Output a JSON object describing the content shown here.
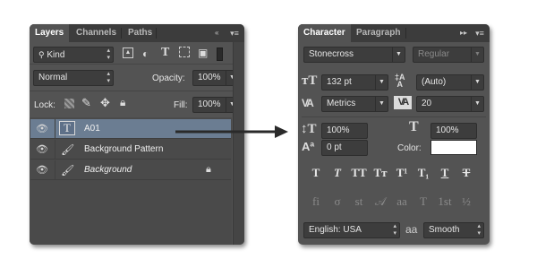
{
  "layers_panel": {
    "tabs": [
      "Layers",
      "Channels",
      "Paths"
    ],
    "filter_kind": "Kind",
    "blend_mode": "Normal",
    "opacity_label": "Opacity:",
    "opacity_value": "100%",
    "lock_label": "Lock:",
    "fill_label": "Fill:",
    "fill_value": "100%",
    "layers": [
      {
        "name": "A01",
        "thumb": "T"
      },
      {
        "name": "Background Pattern"
      },
      {
        "name": "Background"
      }
    ]
  },
  "character_panel": {
    "tabs": [
      "Character",
      "Paragraph"
    ],
    "font_family": "Stonecross",
    "font_style": "Regular",
    "font_size": "132 pt",
    "leading": "(Auto)",
    "kerning": "Metrics",
    "tracking": "20",
    "vertical_scale": "100%",
    "horizontal_scale": "100%",
    "baseline_shift": "0 pt",
    "color_label": "Color:",
    "color_value": "#ffffff",
    "style_buttons": [
      "T",
      "T",
      "TT",
      "Tт",
      "T¹",
      "T₁",
      "T",
      "Ŧ"
    ],
    "opentype_buttons": [
      "fi",
      "σ",
      "st",
      "𝒜",
      "aa",
      "T",
      "1st",
      "½"
    ],
    "language": "English: USA",
    "aa_label": "aa",
    "antialias": "Smooth"
  },
  "colors": {
    "panel": "#535353",
    "tab_bar": "#3c3c3c",
    "selection": "#6b7d92"
  }
}
